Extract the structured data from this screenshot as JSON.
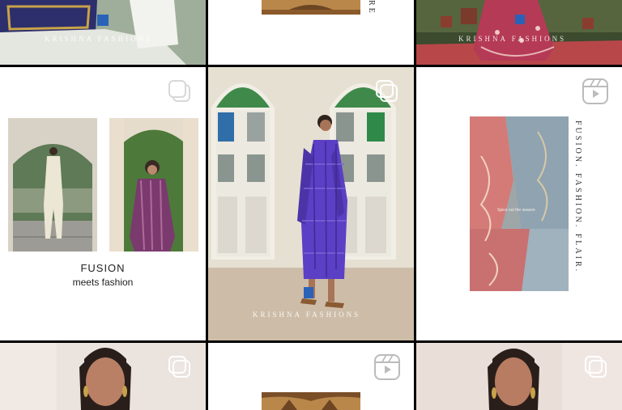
{
  "grid": {
    "watermark": "KRISHNA FASHIONS",
    "tile_fusion": {
      "title": "FUSION",
      "subtitle": "meets fashion"
    },
    "tile_tagline": {
      "vertical_text": "FUSION. FASHION. FLAIR.",
      "fabric_label": "Spice out the season"
    },
    "top_center_vertical_text": "RE",
    "icons": {
      "multi_photo": "carousel-icon",
      "reel": "reels-icon"
    }
  },
  "colors": {
    "divider": "#000000",
    "tile_white": "#ffffff",
    "lavender": "#5b3fc4",
    "pink": "#c55a6e"
  }
}
